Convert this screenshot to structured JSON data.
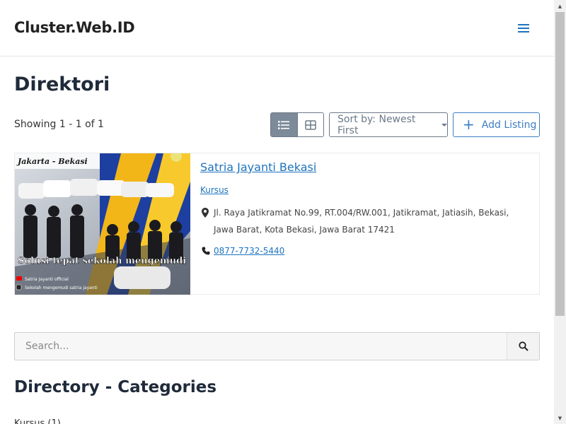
{
  "header": {
    "site_title": "Cluster.Web.ID",
    "menu_icon": "hamburger-icon"
  },
  "main": {
    "page_title": "Direktori",
    "showing_text": "Showing 1 - 1 of 1",
    "view_toggle": {
      "list_icon": "list-view-icon",
      "grid_icon": "grid-view-icon",
      "active": "list"
    },
    "sort_label": "Sort by: Newest First",
    "add_listing_label": "Add Listing",
    "accent_color": "#1e73be"
  },
  "listing": {
    "title": "Satria Jayanti Bekasi",
    "category": "Kursus",
    "address": "Jl. Raya Jatikramat No.99, RT.004/RW.001, Jatikramat, Jatiasih, Bekasi, Jawa Barat, Kota Bekasi, Jawa Barat 17421",
    "phone": "0877-7732-5440",
    "image": {
      "banner_text": "Jakarta - Bekasi",
      "slogan": "Solusi tepat sekolah mengemudi",
      "social_1": "Satria Jayanti official",
      "social_2": "Sekolah mengemudi satria jayanti"
    }
  },
  "search": {
    "placeholder": "Search..."
  },
  "categories": {
    "title": "Directory - Categories",
    "first_item": "Kursus (1)"
  }
}
